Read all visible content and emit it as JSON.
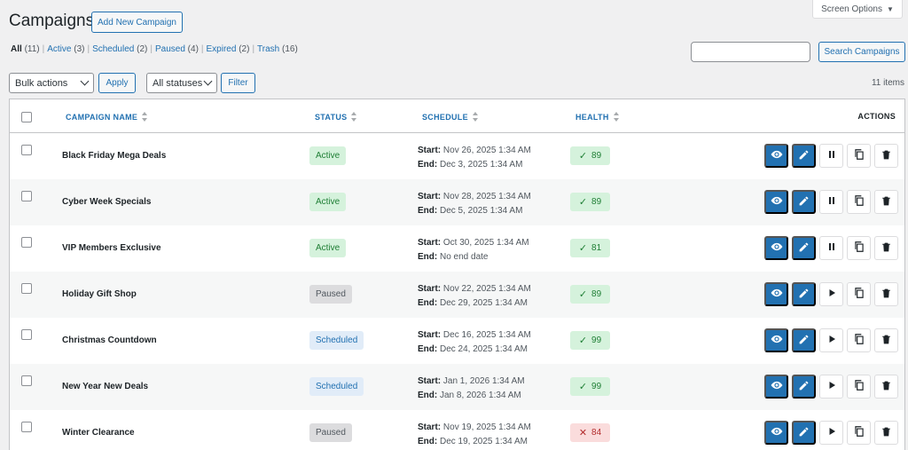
{
  "screen_options": {
    "label": "Screen Options",
    "caret": "▼"
  },
  "header": {
    "title": "Campaigns",
    "add_new": "Add New Campaign"
  },
  "filters": [
    {
      "label": "All",
      "count": "(11)",
      "current": true
    },
    {
      "label": "Active",
      "count": "(3)"
    },
    {
      "label": "Scheduled",
      "count": "(2)"
    },
    {
      "label": "Paused",
      "count": "(4)"
    },
    {
      "label": "Expired",
      "count": "(2)"
    },
    {
      "label": "Trash",
      "count": "(16)"
    }
  ],
  "search": {
    "button": "Search Campaigns",
    "placeholder": ""
  },
  "tablenav": {
    "bulk_actions": "Bulk actions",
    "apply": "Apply",
    "all_statuses": "All statuses",
    "filter": "Filter",
    "items_count": "11 items"
  },
  "columns": {
    "name": "CAMPAIGN NAME",
    "status": "STATUS",
    "schedule": "SCHEDULE",
    "health": "HEALTH",
    "actions": "ACTIONS"
  },
  "schedule_labels": {
    "start": "Start:",
    "end": "End:"
  },
  "rows": [
    {
      "name": "Black Friday Mega Deals",
      "status": "Active",
      "status_type": "active",
      "start": "Nov 26, 2025 1:34 AM",
      "end": "Dec 3, 2025 1:34 AM",
      "health": "89",
      "health_ok": true,
      "toggle": "pause"
    },
    {
      "name": "Cyber Week Specials",
      "status": "Active",
      "status_type": "active",
      "start": "Nov 28, 2025 1:34 AM",
      "end": "Dec 5, 2025 1:34 AM",
      "health": "89",
      "health_ok": true,
      "toggle": "pause"
    },
    {
      "name": "VIP Members Exclusive",
      "status": "Active",
      "status_type": "active",
      "start": "Oct 30, 2025 1:34 AM",
      "end": "No end date",
      "health": "81",
      "health_ok": true,
      "toggle": "pause"
    },
    {
      "name": "Holiday Gift Shop",
      "status": "Paused",
      "status_type": "paused",
      "start": "Nov 22, 2025 1:34 AM",
      "end": "Dec 29, 2025 1:34 AM",
      "health": "89",
      "health_ok": true,
      "toggle": "play"
    },
    {
      "name": "Christmas Countdown",
      "status": "Scheduled",
      "status_type": "scheduled",
      "start": "Dec 16, 2025 1:34 AM",
      "end": "Dec 24, 2025 1:34 AM",
      "health": "99",
      "health_ok": true,
      "toggle": "play"
    },
    {
      "name": "New Year New Deals",
      "status": "Scheduled",
      "status_type": "scheduled",
      "start": "Jan 1, 2026 1:34 AM",
      "end": "Jan 8, 2026 1:34 AM",
      "health": "99",
      "health_ok": true,
      "toggle": "play"
    },
    {
      "name": "Winter Clearance",
      "status": "Paused",
      "status_type": "paused",
      "start": "Nov 19, 2025 1:34 AM",
      "end": "Dec 19, 2025 1:34 AM",
      "health": "84",
      "health_ok": false,
      "toggle": "play"
    }
  ],
  "colors": {
    "primary": "#2271b1",
    "active_bg": "#d5f2dc",
    "paused_bg": "#dcdcde",
    "scheduled_bg": "#e1ecf8",
    "health_bad_bg": "#fadcdc"
  }
}
